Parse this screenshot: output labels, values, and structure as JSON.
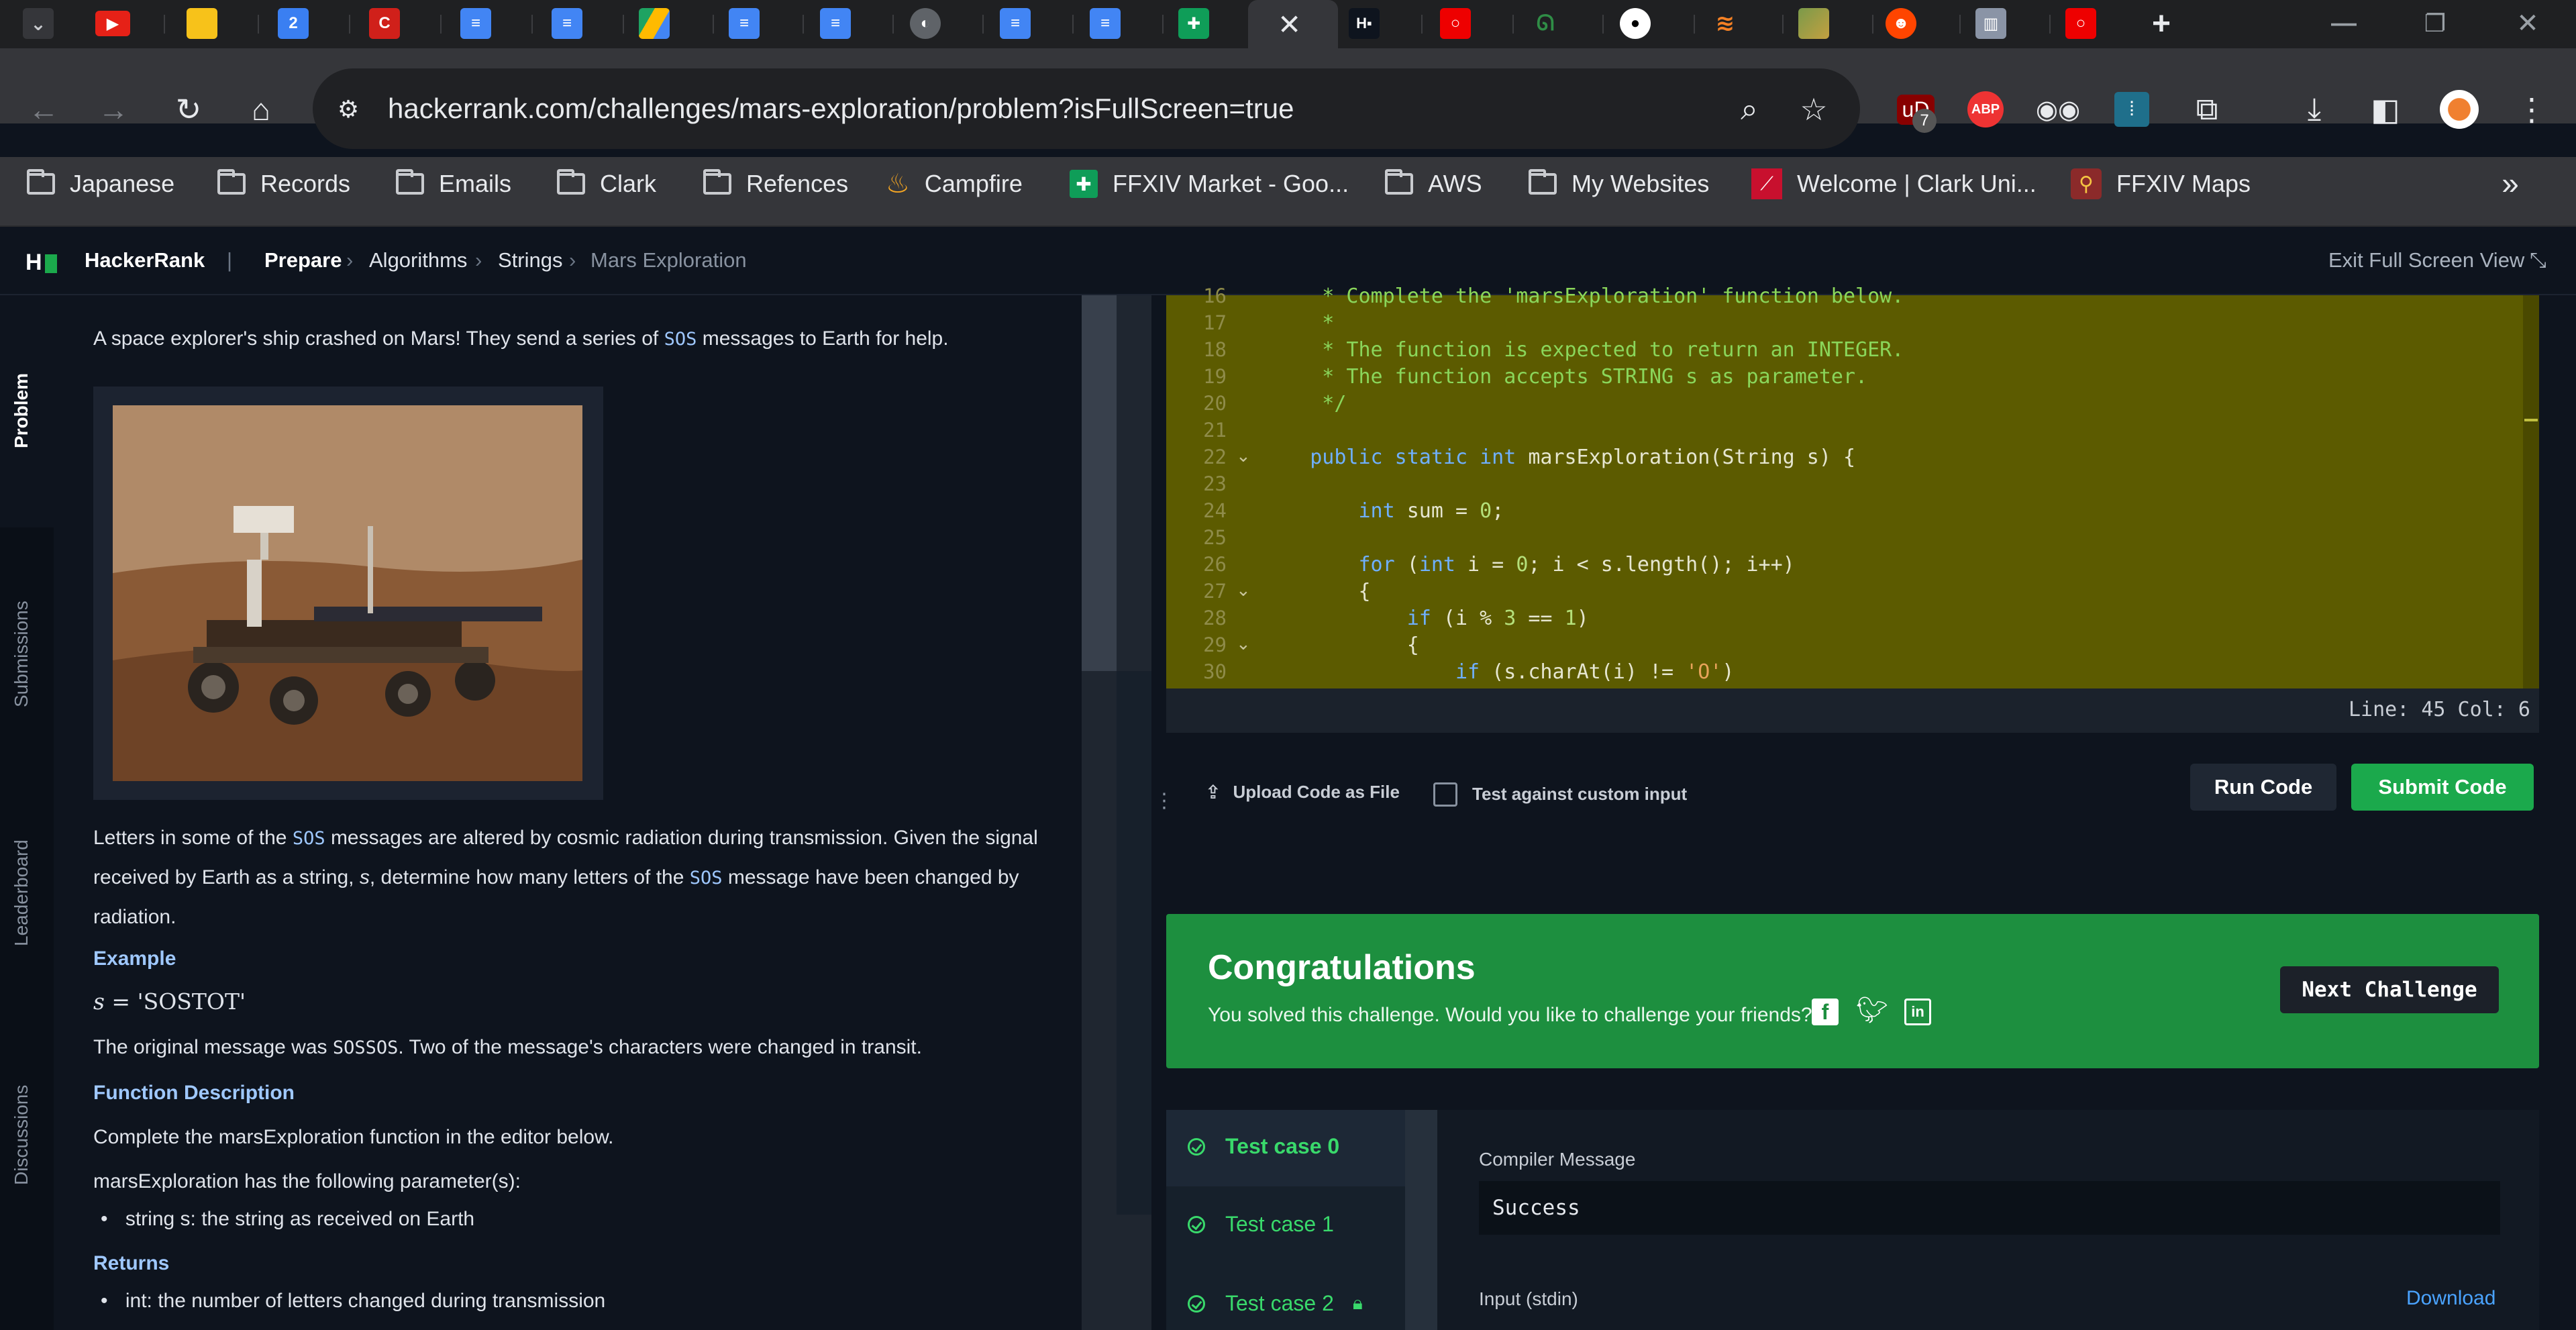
{
  "browser": {
    "url": "hackerrank.com/challenges/mars-exploration/problem?isFullScreen=true",
    "extension_badge": "7",
    "abp_label": "ABP",
    "bookmarks": [
      "Japanese",
      "Records",
      "Emails",
      "Clark",
      "Refences",
      "Campfire",
      "FFXIV Market - Goo...",
      "AWS",
      "My Websites",
      "Welcome | Clark Uni...",
      "FFXIV Maps"
    ]
  },
  "header": {
    "brand": "HackerRank",
    "sep": "|",
    "crumbs": [
      "Prepare",
      "Algorithms",
      "Strings",
      "Mars Exploration"
    ],
    "exit_label": "Exit Full Screen View"
  },
  "sidenav": [
    "Problem",
    "Submissions",
    "Leaderboard",
    "Discussions"
  ],
  "problem": {
    "intro_a": "A space explorer's ship crashed on Mars! They send a series of ",
    "intro_code": "SOS",
    "intro_b": " messages to Earth for help.",
    "p2_a": "Letters in some of the ",
    "p2_code1": "SOS",
    "p2_b": " messages are altered by cosmic radiation during transmission. Given the signal",
    "p2_c": "received by Earth as a string, ",
    "p2_var": "s",
    "p2_d": ", determine how many letters of the ",
    "p2_code2": "SOS",
    "p2_e": " message have been changed by",
    "p2_f": "radiation.",
    "example_h": "Example",
    "example_expr_var": "s",
    "example_expr_eq": " = ",
    "example_expr_val": "'SOSTOT'",
    "p3_a": "The original message was ",
    "p3_code": "SOSSOS",
    "p3_b": ". Two of the message's characters were changed in transit.",
    "func_h": "Function Description",
    "func_p": "Complete the marsExploration function in the editor below.",
    "params_p": "marsExploration has the following parameter(s):",
    "param1": "string s: the string as received on Earth",
    "returns_h": "Returns",
    "return1": "int: the number of letters changed during transmission"
  },
  "editor": {
    "line_numbers": [
      "16",
      "17",
      "18",
      "19",
      "20",
      "21",
      "22",
      "23",
      "24",
      "25",
      "26",
      "27",
      "28",
      "29",
      "30"
    ],
    "status": "Line: 45 Col: 6"
  },
  "actions": {
    "upload": "Upload Code as File",
    "custom_input": "Test against custom input",
    "run": "Run Code",
    "submit": "Submit Code"
  },
  "congrats": {
    "title": "Congratulations",
    "message": "You solved this challenge. Would you like to challenge your friends?",
    "next": "Next Challenge"
  },
  "tests": {
    "cases": [
      "Test case 0",
      "Test case 1",
      "Test case 2"
    ],
    "compiler_label": "Compiler Message",
    "compiler_value": "Success",
    "input_label": "Input (stdin)",
    "download": "Download"
  },
  "colors": {
    "accent_green": "#1ba94c",
    "congrats_bg": "#1d8f3f",
    "editor_highlight": "#5c5b00",
    "link_blue": "#9fc8ff"
  }
}
